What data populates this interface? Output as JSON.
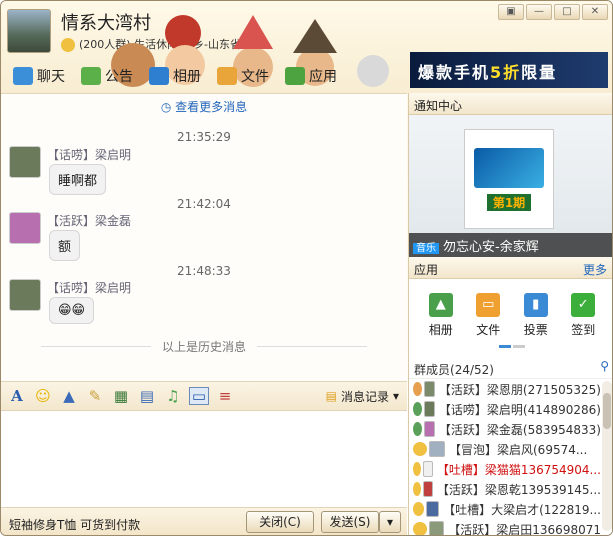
{
  "header": {
    "group_name": "情系大湾村",
    "group_info": "(200人群) 生活休闲-同乡-山东省",
    "window_buttons": [
      "▣",
      "—",
      "□",
      "✕"
    ]
  },
  "tabs": [
    {
      "label": "聊天",
      "color": "#3b8fd9"
    },
    {
      "label": "公告",
      "color": "#5bb04a"
    },
    {
      "label": "相册",
      "color": "#2e7fcf"
    },
    {
      "label": "文件",
      "color": "#e9a43a"
    },
    {
      "label": "应用",
      "color": "#4ea341"
    }
  ],
  "ad": {
    "text": "爆款手机",
    "highlight": "5折",
    "tail": "限量"
  },
  "chat": {
    "more_link": "查看更多消息",
    "messages": [
      {
        "time": "21:35:29",
        "name": "【话唠】梁启明",
        "text": "睡啊都",
        "avatar": "#6a7a5a"
      },
      {
        "time": "21:42:04",
        "name": "【活跃】梁金磊",
        "text": "额",
        "avatar": "#b86fb0"
      },
      {
        "time": "21:48:33",
        "name": "【话唠】梁启明",
        "text": "😁😁",
        "avatar": "#6a7a5a"
      }
    ],
    "history_divider": "以上是历史消息"
  },
  "toolbar": {
    "history_label": "消息记录"
  },
  "bottom": {
    "promo": "短袖修身T恤 可货到付款",
    "close_label": "关闭(C)",
    "send_label": "发送(S)"
  },
  "right": {
    "notice_title": "通知中心",
    "cover_text": "第1期",
    "song_tag": "音乐",
    "song_title": "勿忘心安-余家辉",
    "apps_title": "应用",
    "apps_more": "更多",
    "apps": [
      {
        "label": "相册",
        "color": "#4aa04a"
      },
      {
        "label": "文件",
        "color": "#f0a030"
      },
      {
        "label": "投票",
        "color": "#3a8ad6"
      },
      {
        "label": "签到",
        "color": "#3cae3c"
      }
    ],
    "members_title": "群成员",
    "members_count": "(24/52)",
    "members": [
      {
        "text": "【活跃】梁恩朋(271505325)",
        "color": "#222"
      },
      {
        "text": "【话唠】梁启明(414890286)",
        "color": "#222"
      },
      {
        "text": "【活跃】梁金磊(583954833)",
        "color": "#222"
      },
      {
        "text": "【冒泡】梁启风(69574...",
        "color": "#222"
      },
      {
        "text": "【吐槽】梁猫猫136754904...",
        "color": "#d01010"
      },
      {
        "text": "【活跃】梁恩乾139539145...",
        "color": "#222"
      },
      {
        "text": "【吐槽】大梁启才(122819...",
        "color": "#222"
      },
      {
        "text": "【活跃】梁启田136698071",
        "color": "#222"
      }
    ]
  }
}
